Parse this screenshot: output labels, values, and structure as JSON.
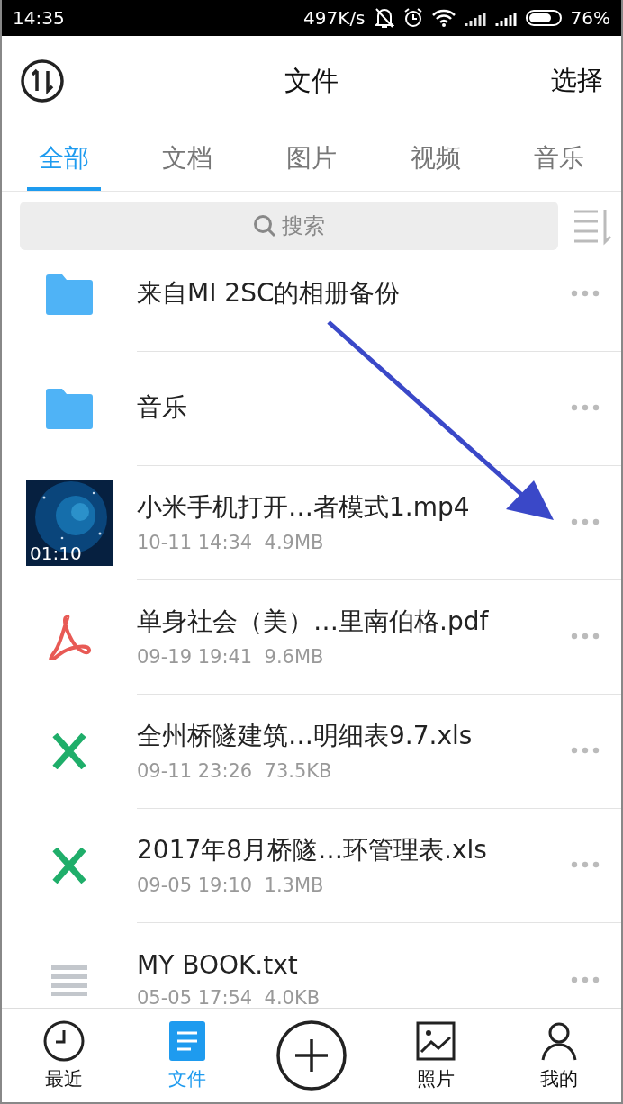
{
  "status_bar": {
    "time": "14:35",
    "speed": "497K/s",
    "battery": "76%"
  },
  "header": {
    "title": "文件",
    "action": "选择"
  },
  "tabs": [
    {
      "label": "全部",
      "selected": true
    },
    {
      "label": "文档",
      "selected": false
    },
    {
      "label": "图片",
      "selected": false
    },
    {
      "label": "视频",
      "selected": false
    },
    {
      "label": "音乐",
      "selected": false
    }
  ],
  "search": {
    "placeholder": "搜索"
  },
  "files": [
    {
      "kind": "folder",
      "name": "来自MI 2SC的相册备份"
    },
    {
      "kind": "folder",
      "name": "音乐"
    },
    {
      "kind": "video",
      "name": "小米手机打开…者模式1.mp4",
      "meta": "10-11 14:34  4.9MB",
      "duration": "01:10"
    },
    {
      "kind": "pdf",
      "name": "单身社会（美）…里南伯格.pdf",
      "meta": "09-19 19:41  9.6MB"
    },
    {
      "kind": "xls",
      "name": "全州桥隧建筑…明细表9.7.xls",
      "meta": "09-11 23:26  73.5KB"
    },
    {
      "kind": "xls",
      "name": "2017年8月桥隧…环管理表.xls",
      "meta": "09-05 19:10  1.3MB"
    },
    {
      "kind": "txt",
      "name": "MY BOOK.txt",
      "meta": "05-05 17:54  4.0KB"
    }
  ],
  "bottom_nav": [
    {
      "kind": "recent",
      "label": "最近",
      "selected": false
    },
    {
      "kind": "files",
      "label": "文件",
      "selected": true
    },
    {
      "kind": "add"
    },
    {
      "kind": "photos",
      "label": "照片",
      "selected": false
    },
    {
      "kind": "mine",
      "label": "我的",
      "selected": false
    }
  ]
}
